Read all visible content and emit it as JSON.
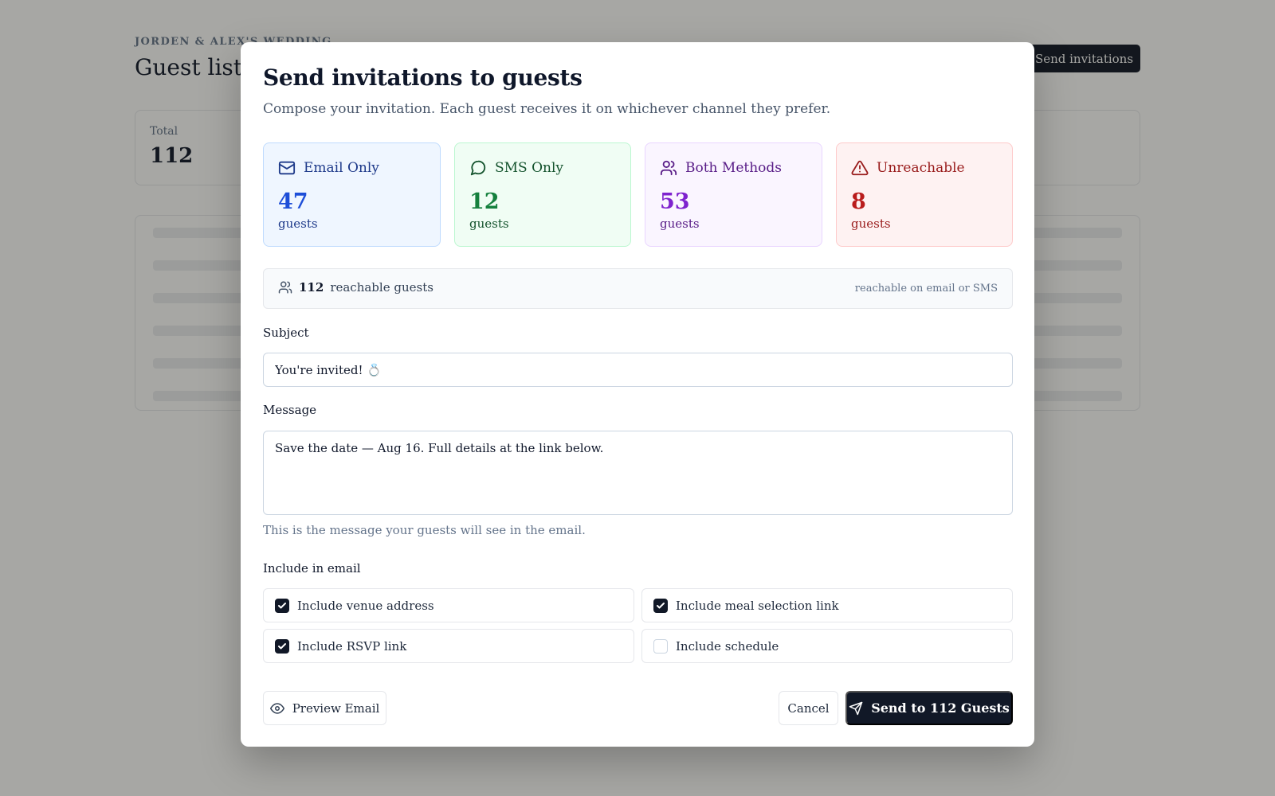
{
  "background": {
    "eyebrow": "JORDEN & ALEX'S WEDDING",
    "title": "Guest list",
    "send_button": "Send invitations",
    "total_label": "Total",
    "total_value": "112"
  },
  "modal": {
    "title": "Send invitations to guests",
    "subtitle": "Compose your invitation. Each guest receives it on whichever channel they prefer.",
    "channels": [
      {
        "label": "Email Only",
        "count": "47",
        "unit": "guests",
        "icon": "mail-icon",
        "color": "#1d4ed8"
      },
      {
        "label": "SMS Only",
        "count": "12",
        "unit": "guests",
        "icon": "message-circle-icon",
        "color": "#15803d"
      },
      {
        "label": "Both Methods",
        "count": "53",
        "unit": "guests",
        "icon": "users-icon",
        "color": "#7e22ce"
      },
      {
        "label": "Unreachable",
        "count": "8",
        "unit": "guests",
        "icon": "alert-triangle-icon",
        "color": "#b91c1c"
      }
    ],
    "reachable": {
      "count": "112",
      "label": "reachable guests",
      "note": "reachable on email or SMS"
    },
    "subject": {
      "label": "Subject",
      "value": "You're invited! 💍"
    },
    "message": {
      "label": "Message",
      "value": "Save the date — Aug 16. Full details at the link below.",
      "hint": "This is the message your guests will see in the email."
    },
    "include": {
      "label": "Include in email",
      "options": [
        {
          "label": "Include venue address",
          "checked": true
        },
        {
          "label": "Include meal selection link",
          "checked": true
        },
        {
          "label": "Include RSVP link",
          "checked": true
        },
        {
          "label": "Include schedule",
          "checked": false
        }
      ]
    },
    "buttons": {
      "preview": "Preview Email",
      "cancel": "Cancel",
      "send": "Send to 112 Guests"
    }
  }
}
